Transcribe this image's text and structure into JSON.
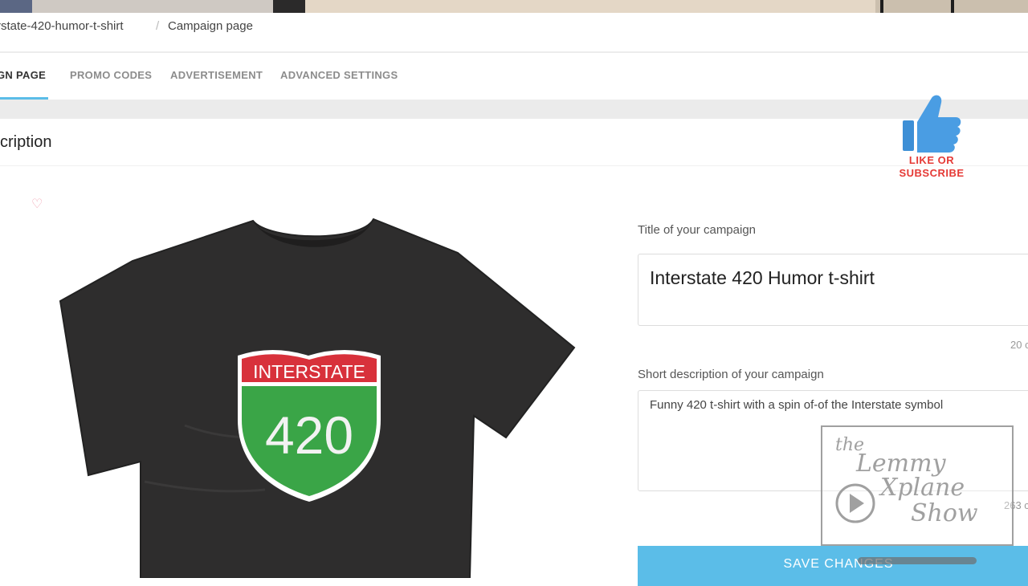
{
  "breadcrumb": {
    "items": [
      "rstate-420-humor-t-shirt",
      "Campaign page"
    ],
    "separator": "/"
  },
  "tabs": [
    {
      "label": "GN PAGE",
      "active": true
    },
    {
      "label": "PROMO CODES",
      "active": false
    },
    {
      "label": "ADVERTISEMENT",
      "active": false
    },
    {
      "label": "ADVANCED SETTINGS",
      "active": false
    }
  ],
  "section": {
    "title": "cription"
  },
  "product": {
    "favorite_icon": "heart-icon",
    "shirt_color": "#2e2d2d",
    "sign": {
      "top_text": "INTERSTATE",
      "number": "420",
      "top_color": "#d8313b",
      "bottom_color": "#3aa547"
    }
  },
  "form": {
    "title_label": "Title of your campaign",
    "title_value": "Interstate 420 Humor t-shirt",
    "title_counter": "20 c",
    "desc_label": "Short description of your campaign",
    "desc_value": "Funny 420 t-shirt with a spin of-of the Interstate symbol",
    "desc_counter": "263 c",
    "save_label": "SAVE CHANGES"
  },
  "overlay": {
    "like_line1": "LIKE OR",
    "like_line2": "SUBSCRIBE",
    "like_icon": "thumbs-up-icon",
    "watermark": [
      "the",
      "Lemmy",
      "Xplane",
      "Show"
    ],
    "play_icon": "play-icon"
  },
  "colors": {
    "accent": "#5bbde8",
    "like_red": "#e53935"
  }
}
